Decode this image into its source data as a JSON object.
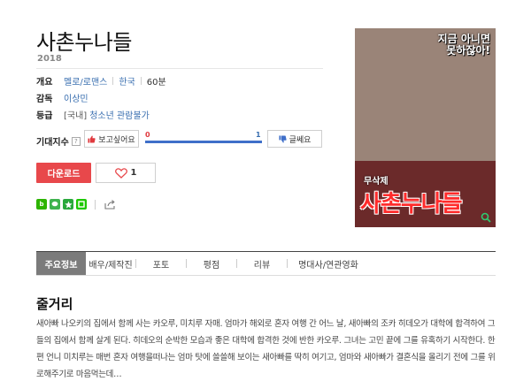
{
  "movie": {
    "title": "사촌누나들",
    "year": "2018"
  },
  "info": {
    "overview_label": "개요",
    "genre": "멜로/로맨스",
    "country": "한국",
    "runtime": "60분",
    "director_label": "감독",
    "director": "이상민",
    "rating_label": "등급",
    "rating_region": "[국내]",
    "rating": "청소년 관람불가"
  },
  "expectation": {
    "label": "기대지수",
    "help_icon": "?",
    "want_label": "보고싶어요",
    "meh_label": "글쎄요",
    "want_count": "0",
    "meh_count": "1",
    "want_fraction": 0.0,
    "want_color": "#e0393e",
    "meh_color": "#3f6fc9"
  },
  "actions": {
    "download_label": "다운로드",
    "like_count": "1"
  },
  "share": {
    "icons": [
      "naver-blog-icon",
      "kakaostory-icon",
      "bookmark-star-icon",
      "band-icon"
    ],
    "share_icon": "share-icon"
  },
  "poster": {
    "tagline": "지금 아니면 못하잖아!",
    "subtitle": "무삭제",
    "title": "사촌누나들"
  },
  "tabs": [
    {
      "label": "주요정보",
      "active": true
    },
    {
      "label": "배우/제작진"
    },
    {
      "label": "포토"
    },
    {
      "label": "평점"
    },
    {
      "label": "리뷰"
    },
    {
      "label": "명대사/연관영화"
    }
  ],
  "synopsis": {
    "heading": "줄거리",
    "text": "새아빠 나오키의 집에서 함께 사는 카오루, 미치루 자매. 엄마가 해외로 혼자 여행 간 어느 날, 새아빠의 조카 히데오가 대학에 합격하여 그들의 집에서 함께 살게 된다. 히데오의 순박한 모습과 좋은 대학에 합격한 것에 반한 카오루. 그녀는 고민 끝에 그를 유혹하기 시작한다. 한편 언니 미치루는 매번 혼자 여행을떠나는 엄마 탓에 쓸쓸해 보이는 새아빠를 딱히 여기고, 엄마와 새아빠가 결혼식을 올리기 전에 그를 위로해주기로 마음먹는데…"
  },
  "colors": {
    "accent_red": "#e8484b",
    "link_blue": "#3a6fb0",
    "tab_active_bg": "#7b7b7b"
  }
}
